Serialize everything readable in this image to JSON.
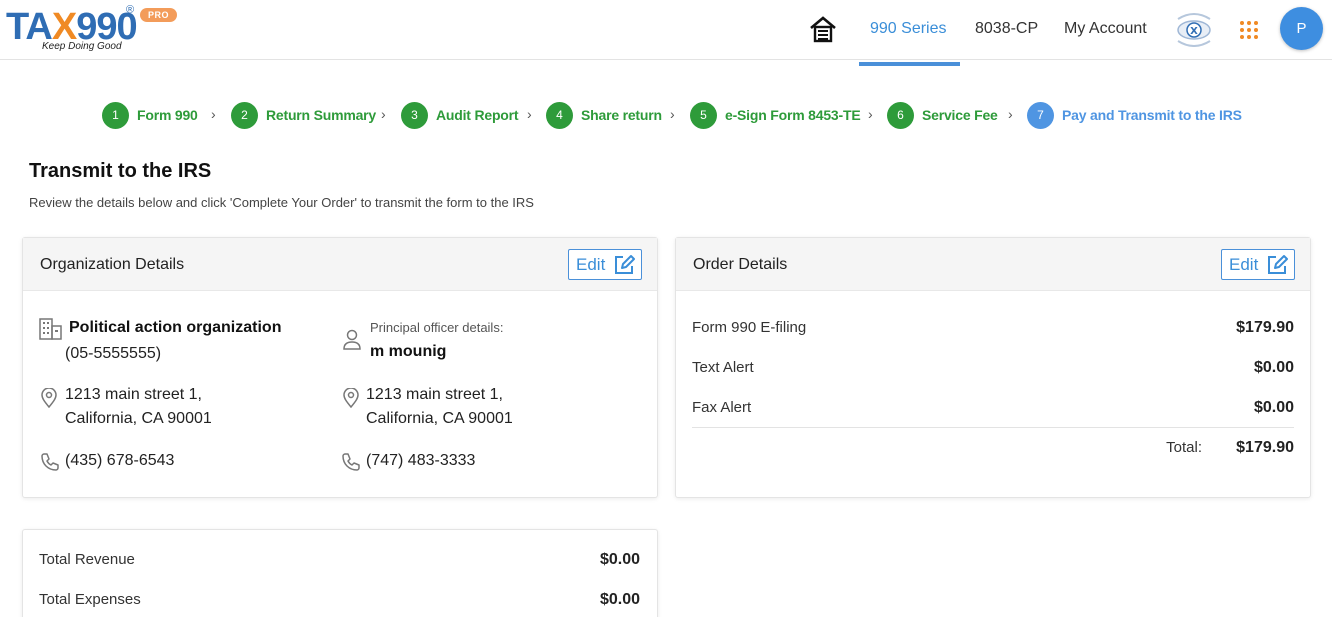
{
  "header": {
    "logo": {
      "brand": "TAX990",
      "reg": "®",
      "badge": "PRO",
      "tagline": "Keep Doing Good"
    },
    "nav": [
      {
        "label": "990 Series",
        "active": true
      },
      {
        "label": "8038-CP",
        "active": false
      },
      {
        "label": "My Account",
        "active": false
      }
    ],
    "avatar_initial": "P",
    "accent_color": "#4a90d9"
  },
  "stepper": [
    {
      "num": "1",
      "label": "Form 990",
      "state": "done"
    },
    {
      "num": "2",
      "label": "Return Summary",
      "state": "done"
    },
    {
      "num": "3",
      "label": "Audit Report",
      "state": "done"
    },
    {
      "num": "4",
      "label": "Share return",
      "state": "done"
    },
    {
      "num": "5",
      "label": "e-Sign Form 8453-TE",
      "state": "done"
    },
    {
      "num": "6",
      "label": "Service Fee",
      "state": "done"
    },
    {
      "num": "7",
      "label": "Pay and Transmit to the IRS",
      "state": "current"
    }
  ],
  "page": {
    "title": "Transmit to the IRS",
    "subtitle": "Review the details below and click 'Complete Your Order' to transmit the form to the IRS"
  },
  "org_card": {
    "title": "Organization Details",
    "edit_label": "Edit",
    "org_name": "Political action organization",
    "ein": "(05-5555555)",
    "address_line1": "1213 main street 1,",
    "address_line2": "California, CA 90001",
    "phone": "(435) 678-6543",
    "officer_label": "Principal officer details:",
    "officer_name": "m mounig",
    "officer_address_line1": "1213 main street 1,",
    "officer_address_line2": "California, CA 90001",
    "officer_phone": "(747) 483-3333"
  },
  "order_card": {
    "title": "Order Details",
    "edit_label": "Edit",
    "items": [
      {
        "label": "Form 990 E-filing",
        "value": "$179.90"
      },
      {
        "label": "Text Alert",
        "value": "$0.00"
      },
      {
        "label": "Fax Alert",
        "value": "$0.00"
      }
    ],
    "total_label": "Total:",
    "total_value": "$179.90"
  },
  "financial_card": {
    "rows": [
      {
        "label": "Total Revenue",
        "value": "$0.00"
      },
      {
        "label": "Total Expenses",
        "value": "$0.00"
      }
    ]
  },
  "icons": {
    "home": "home-icon",
    "grid": "apps-grid-icon",
    "building": "building-icon",
    "person": "person-icon",
    "location": "location-pin-icon",
    "phone": "phone-icon",
    "edit": "edit-pencil-icon"
  }
}
